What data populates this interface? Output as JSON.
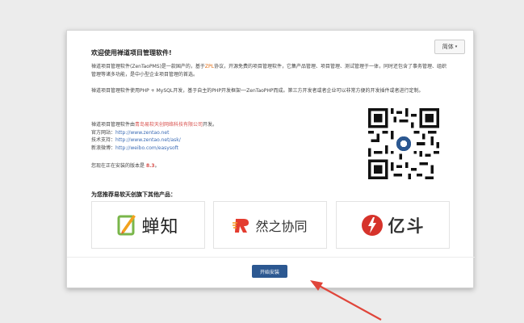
{
  "language_button": {
    "label": "简体",
    "caret": "▾"
  },
  "welcome": {
    "title": "欢迎使用禅道项目管理软件!"
  },
  "intro": {
    "p1_a": "禅道项目管理软件(ZenTaoPMS)是一款国产的，基于",
    "p1_zpl": "ZPL",
    "p1_b": "协议，开源免费的项目管理软件，它集产品管理、项目管理、测试管理于一体，同时还包含了事务管理、组织管理等诸多功能，是中小型企业项目管理的首选。",
    "p2": "禅道项目管理软件使用PHP + MySQL开发，基于自主的PHP开发框架──ZenTaoPHP而成。第三方开发者或者企业可以非常方便的开发插件或者进行定制。"
  },
  "developer": {
    "prefix": "禅道项目管理软件由",
    "company": "青岛易软天创网络科技有限公司",
    "suffix": "开发。"
  },
  "links": [
    {
      "label": "官方网站：",
      "url": "http://www.zentao.net"
    },
    {
      "label": "技术支持：",
      "url": "http://www.zentao.net/ask/"
    },
    {
      "label": "新浪微博：",
      "url": "http://weibo.com/easysoft"
    }
  ],
  "version": {
    "prefix": "您现在正在安装的版本是",
    "number": "8.3",
    "suffix": "。"
  },
  "recommend": {
    "title": "为您推荐易软天创旗下其他产品："
  },
  "products": [
    {
      "name": "蝉知"
    },
    {
      "name": "然之协同"
    },
    {
      "name": "亿斗"
    }
  ],
  "install": {
    "label": "开始安装"
  },
  "colors": {
    "accent": "#2c5891",
    "orange": "#e06a10",
    "red": "#d9534f",
    "link": "#3b6bb5"
  }
}
